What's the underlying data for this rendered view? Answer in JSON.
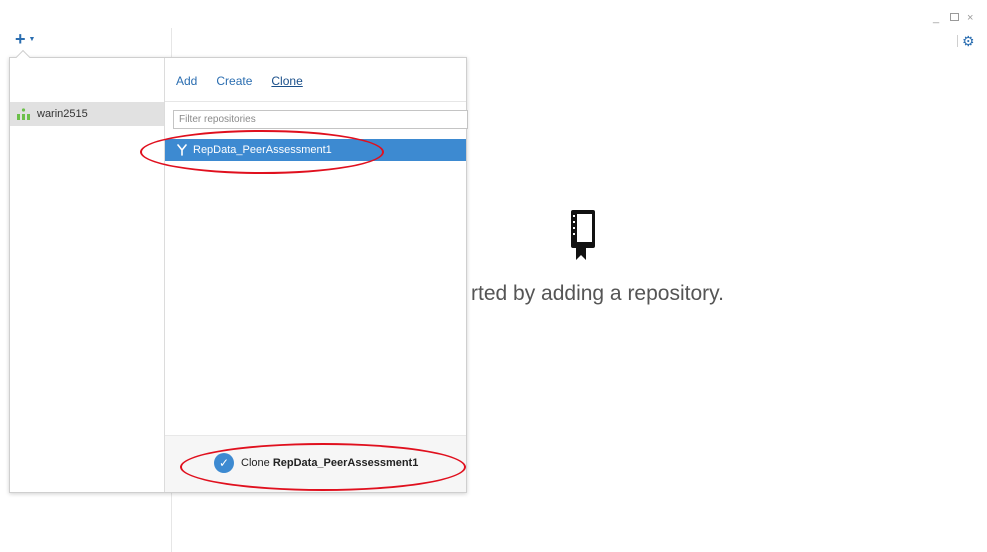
{
  "toolbar": {
    "add_icon": "plus-icon",
    "add_caret": "chevron-down-icon",
    "settings_icon": "gear-icon"
  },
  "window_controls": {
    "minimize": "_",
    "close": "×"
  },
  "empty_state": {
    "icon": "repository-book-icon",
    "message": "rted by adding a repository."
  },
  "popover": {
    "account": {
      "name": "warin2515",
      "icon": "organization-icon"
    },
    "tabs": [
      {
        "label": "Add",
        "active": false
      },
      {
        "label": "Create",
        "active": false
      },
      {
        "label": "Clone",
        "active": true
      }
    ],
    "filter": {
      "placeholder": "Filter repositories",
      "value": ""
    },
    "repositories": [
      {
        "name": "RepData_PeerAssessment1",
        "icon": "fork-icon",
        "selected": true
      }
    ],
    "footer": {
      "action_prefix": "Clone",
      "action_repo": "RepData_PeerAssessment1",
      "icon": "check-circle-icon"
    }
  },
  "colors": {
    "accent": "#2a6db0",
    "selection": "#3d8ad1",
    "annotation": "#e0101e"
  }
}
